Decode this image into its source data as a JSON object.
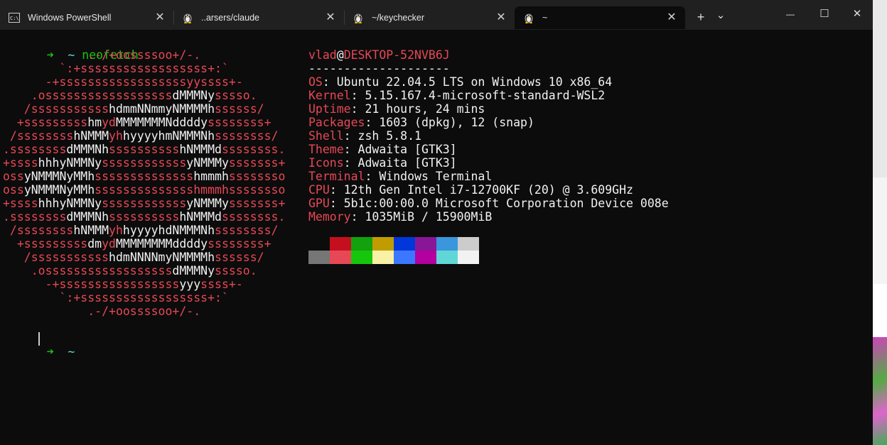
{
  "tabs": [
    {
      "label": "Windows PowerShell",
      "icon": "powershell-icon"
    },
    {
      "label": "..arsers/claude",
      "icon": "linux-penguin-icon"
    },
    {
      "label": "~/keychecker",
      "icon": "linux-penguin-icon"
    },
    {
      "label": "~",
      "icon": "linux-penguin-icon"
    }
  ],
  "titlebar": {
    "new_tab": "+",
    "dropdown": "⌄",
    "minimize": "—",
    "maximize": "☐",
    "close": "✕"
  },
  "terminal": {
    "prompt_arrow": "➜",
    "prompt_dir": "~",
    "command": "neofetch",
    "user": "vlad",
    "at": "@",
    "host": "DESKTOP-52NVB6J",
    "separator": "--------------------",
    "info": [
      {
        "key": "OS",
        "value": "Ubuntu 22.04.5 LTS on Windows 10 x86_64"
      },
      {
        "key": "Kernel",
        "value": "5.15.167.4-microsoft-standard-WSL2"
      },
      {
        "key": "Uptime",
        "value": "21 hours, 24 mins"
      },
      {
        "key": "Packages",
        "value": "1603 (dpkg), 12 (snap)"
      },
      {
        "key": "Shell",
        "value": "zsh 5.8.1"
      },
      {
        "key": "Theme",
        "value": "Adwaita [GTK3]"
      },
      {
        "key": "Icons",
        "value": "Adwaita [GTK3]"
      },
      {
        "key": "Terminal",
        "value": "Windows Terminal"
      },
      {
        "key": "CPU",
        "value": "12th Gen Intel i7-12700KF (20) @ 3.609GHz"
      },
      {
        "key": "GPU",
        "value": "5b1c:00:00.0 Microsoft Corporation Device 008e"
      },
      {
        "key": "Memory",
        "value": "1035MiB / 15900MiB"
      }
    ],
    "info_colon": ": ",
    "ascii_logo": [
      [
        [
          "            .-/+oossssoo+/-.",
          "r"
        ]
      ],
      [
        [
          "        `:+ssssssssssssssssss+:`",
          "r"
        ]
      ],
      [
        [
          "      -+ssssssssssssssssssyyssss+-",
          "r"
        ]
      ],
      [
        [
          "    .ossssssssssssssssss",
          "r"
        ],
        [
          "dMMMNy",
          "w"
        ],
        [
          "sssso.",
          "r"
        ]
      ],
      [
        [
          "   /sssssssssss",
          "r"
        ],
        [
          "hdmmNNmmyNMMMMh",
          "w"
        ],
        [
          "ssssss/",
          "r"
        ]
      ],
      [
        [
          "  +sssssssss",
          "r"
        ],
        [
          "hm",
          "w"
        ],
        [
          "yd",
          "r"
        ],
        [
          "MMMMMMMNddddy",
          "w"
        ],
        [
          "ssssssss+",
          "r"
        ]
      ],
      [
        [
          " /ssssssss",
          "r"
        ],
        [
          "hNMMM",
          "w"
        ],
        [
          "yh",
          "r"
        ],
        [
          "hyyyyhmNMMMNh",
          "w"
        ],
        [
          "ssssssss/",
          "r"
        ]
      ],
      [
        [
          ".ssssssss",
          "r"
        ],
        [
          "dMMMNh",
          "w"
        ],
        [
          "ssssssssss",
          "r"
        ],
        [
          "hNMMMd",
          "w"
        ],
        [
          "ssssssss.",
          "r"
        ]
      ],
      [
        [
          "+ssss",
          "r"
        ],
        [
          "hhhyNMMNy",
          "w"
        ],
        [
          "ssssssssssss",
          "r"
        ],
        [
          "yNMMMy",
          "w"
        ],
        [
          "sssssss+",
          "r"
        ]
      ],
      [
        [
          "oss",
          "r"
        ],
        [
          "yNMMMNyMMh",
          "w"
        ],
        [
          "ssssssssssssss",
          "r"
        ],
        [
          "hmmmh",
          "w"
        ],
        [
          "ssssssso",
          "r"
        ]
      ],
      [
        [
          "oss",
          "r"
        ],
        [
          "yNMMMNyMMh",
          "w"
        ],
        [
          "sssssssssssssshmmmh",
          "r"
        ],
        [
          "ssssssso",
          "r"
        ]
      ],
      [
        [
          "+ssss",
          "r"
        ],
        [
          "hhhyNMMNy",
          "w"
        ],
        [
          "ssssssssssss",
          "r"
        ],
        [
          "yNMMMy",
          "w"
        ],
        [
          "sssssss+",
          "r"
        ]
      ],
      [
        [
          ".ssssssss",
          "r"
        ],
        [
          "dMMMNh",
          "w"
        ],
        [
          "ssssssssss",
          "r"
        ],
        [
          "hNMMMd",
          "w"
        ],
        [
          "ssssssss.",
          "r"
        ]
      ],
      [
        [
          " /ssssssss",
          "r"
        ],
        [
          "hNMMM",
          "w"
        ],
        [
          "yh",
          "r"
        ],
        [
          "hyyyyhdNMMMNh",
          "w"
        ],
        [
          "ssssssss/",
          "r"
        ]
      ],
      [
        [
          "  +sssssssss",
          "r"
        ],
        [
          "dm",
          "w"
        ],
        [
          "yd",
          "r"
        ],
        [
          "MMMMMMMMddddy",
          "w"
        ],
        [
          "ssssssss+",
          "r"
        ]
      ],
      [
        [
          "   /sssssssssss",
          "r"
        ],
        [
          "hdmNNNNmyNMMMMh",
          "w"
        ],
        [
          "ssssss/",
          "r"
        ]
      ],
      [
        [
          "    .ossssssssssssssssss",
          "r"
        ],
        [
          "dMMMNy",
          "w"
        ],
        [
          "sssso.",
          "r"
        ]
      ],
      [
        [
          "      -+sssssssssssssssss",
          "r"
        ],
        [
          "yyy",
          "w"
        ],
        [
          "ssss+-",
          "r"
        ]
      ],
      [
        [
          "        `:+ssssssssssssssssss+:`",
          "r"
        ]
      ],
      [
        [
          "            .-/+oossssoo+/-.",
          "r"
        ]
      ]
    ],
    "colors_top": [
      "#0c0c0c",
      "#c50f1f",
      "#13a10e",
      "#c19c00",
      "#0037da",
      "#881798",
      "#3a96dd",
      "#cccccc"
    ],
    "colors_bottom": [
      "#767676",
      "#e74856",
      "#16c60c",
      "#f9f1a5",
      "#3b78ff",
      "#b4009e",
      "#61d6d6",
      "#f2f2f2"
    ]
  }
}
